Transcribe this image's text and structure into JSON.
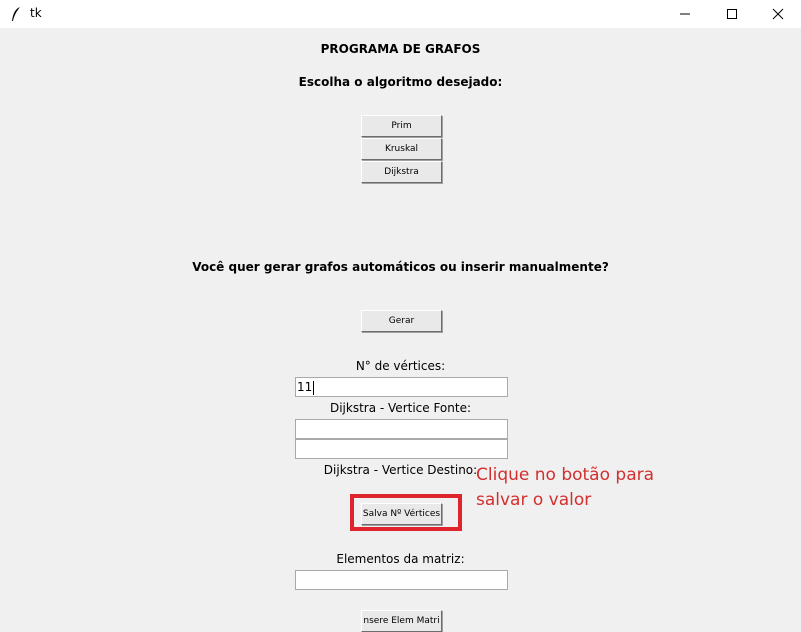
{
  "window": {
    "title": "tk"
  },
  "header": {
    "program_title": "PROGRAMA DE GRAFOS",
    "choose_prompt": "Escolha o algoritmo desejado:"
  },
  "algorithms": {
    "prim_label": "Prim",
    "kruskal_label": "Kruskal",
    "dijkstra_label": "Dijkstra"
  },
  "generation": {
    "question": "Você quer gerar grafos automáticos ou inserir manualmente?",
    "generate_label": "Gerar"
  },
  "form": {
    "vertices_label": "N° de vértices:",
    "vertices_value": "11",
    "source_label": "Dijkstra - Vertice Fonte:",
    "source_value": "",
    "destination_value": "",
    "destination_label": "Dijkstra - Vertice Destino:",
    "save_vertices_label": "Salva Nº Vértices",
    "matrix_label": "Elementos da matriz:",
    "matrix_value": "",
    "insert_matrix_label": "nsere Elem Matri"
  },
  "annotation": {
    "line1": "Clique no botão para",
    "line2": "salvar o valor",
    "color": "#d32f2f",
    "box_color": "#e0242d"
  }
}
